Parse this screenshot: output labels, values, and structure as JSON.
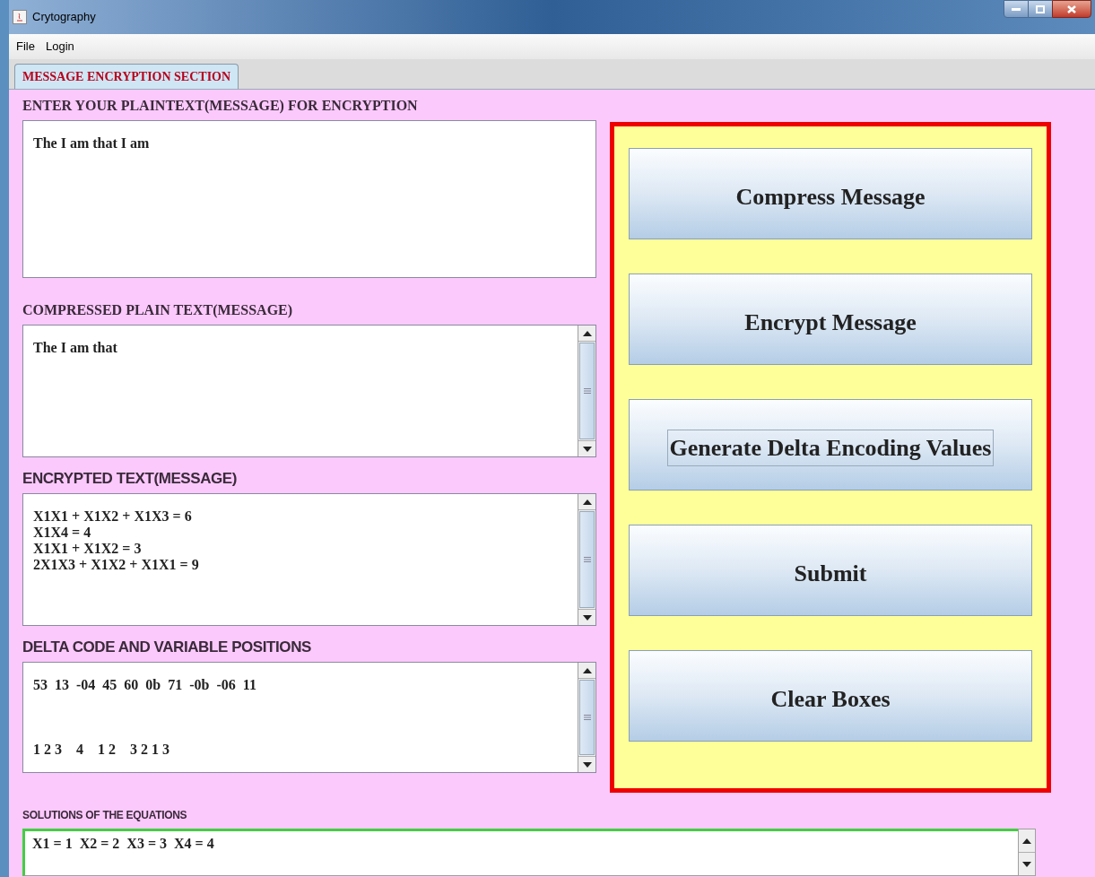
{
  "window": {
    "title": "Crytography"
  },
  "menu": [
    "File",
    "Login"
  ],
  "tabs": [
    {
      "label": "MESSAGE ENCRYPTION SECTION",
      "selected": true
    }
  ],
  "sections": [
    {
      "label": "ENTER YOUR PLAINTEXT(MESSAGE) FOR ENCRYPTION",
      "kind": "serif",
      "lines": [
        "The I am that I am"
      ],
      "scrollbar": false
    },
    {
      "label": "COMPRESSED PLAIN TEXT(MESSAGE)",
      "kind": "serif",
      "lines": [
        "The I am that"
      ],
      "scrollbar": true
    },
    {
      "label": "ENCRYPTED TEXT(MESSAGE)",
      "kind": "sans",
      "lines": [
        "X1X1 + X1X2 + X1X3 = 6",
        "X1X4 = 4",
        "X1X1 + X1X2 = 3",
        "2X1X3 + X1X2 + X1X1 = 9"
      ],
      "scrollbar": true
    },
    {
      "label": "DELTA CODE AND VARIABLE POSITIONS",
      "kind": "sans",
      "lines": [
        "53  13  -04  45  60  0b  71  -0b  -06  11",
        "1 2 3    4    1 2    3 2 1 3"
      ],
      "scrollbar": true
    }
  ],
  "buttons": [
    {
      "label": "Compress Message",
      "focused": false
    },
    {
      "label": "Encrypt Message",
      "focused": false
    },
    {
      "label": "Generate Delta Encoding Values",
      "focused": true
    },
    {
      "label": "Submit",
      "focused": false
    },
    {
      "label": "Clear Boxes",
      "focused": false
    }
  ],
  "solutions": {
    "label": "SOLUTIONS OF THE EQUATIONS",
    "value": "X1 = 1  X2 = 2  X3 = 3  X4 = 4"
  }
}
